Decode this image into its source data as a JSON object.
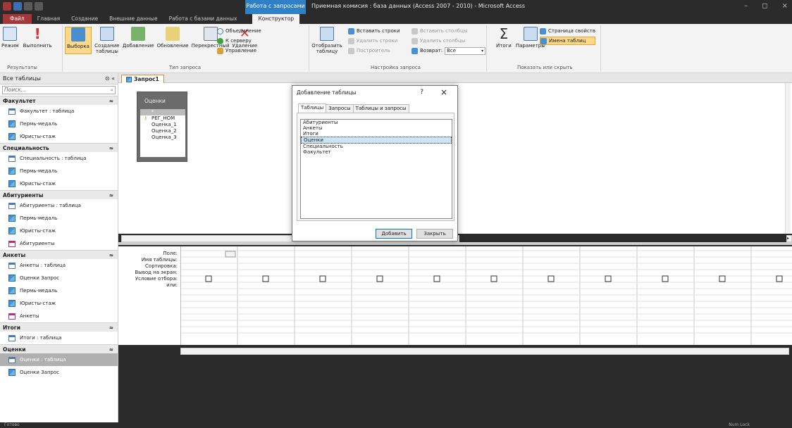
{
  "window": {
    "context_group": "Работа с запросами",
    "title": "Приемная комисия : база данных (Access 2007 - 2010) - Microsoft Access",
    "min": "–",
    "max": "◻",
    "close": "×"
  },
  "tabs": [
    "Файл",
    "Главная",
    "Создание",
    "Внешние данные",
    "Работа с базами данных",
    "Конструктор"
  ],
  "ribbon": {
    "results": {
      "label": "Результаты",
      "view": "Режим",
      "run": "Выполнить"
    },
    "query_type": {
      "label": "Тип запроса",
      "select": "Выборка",
      "make_table": "Создание таблицы",
      "append": "Добавление",
      "update": "Обновление",
      "crosstab": "Перекрестный",
      "delete": "Удаление",
      "union": "Объединение",
      "passthrough": "К серверу",
      "ddl": "Управление"
    },
    "setup": {
      "label": "Настройка запроса",
      "show_table": "Отобразить таблицу",
      "insert_rows": "Вставить строки",
      "delete_rows": "Удалить строки",
      "builder": "Построитель",
      "insert_cols": "Вставить столбцы",
      "delete_cols": "Удалить столбцы",
      "return": "Возврат:",
      "return_value": "Все"
    },
    "showhide": {
      "label": "Показать или скрыть",
      "totals": "Итоги",
      "params": "Параметры",
      "prop_sheet": "Страница свойств",
      "table_names": "Имена таблиц"
    }
  },
  "nav": {
    "header": "Все таблицы",
    "search_placeholder": "Поиск...",
    "groups": [
      {
        "name": "Факультет",
        "items": [
          {
            "label": "Факультет : таблица",
            "kind": "table"
          },
          {
            "label": "Пермь-медаль",
            "kind": "query"
          },
          {
            "label": "Юристы-стаж",
            "kind": "query"
          }
        ]
      },
      {
        "name": "Специальность",
        "items": [
          {
            "label": "Специальность : таблица",
            "kind": "table"
          },
          {
            "label": "Пермь-медаль",
            "kind": "query"
          },
          {
            "label": "Юристы-стаж",
            "kind": "query"
          }
        ]
      },
      {
        "name": "Абитуриенты",
        "items": [
          {
            "label": "Абитуриенты : таблица",
            "kind": "table"
          },
          {
            "label": "Пермь-медаль",
            "kind": "query"
          },
          {
            "label": "Юристы-стаж",
            "kind": "query"
          },
          {
            "label": "Абитуриенты",
            "kind": "form"
          }
        ]
      },
      {
        "name": "Анкеты",
        "items": [
          {
            "label": "Анкеты : таблица",
            "kind": "table"
          },
          {
            "label": "Оценки Запрос",
            "kind": "query"
          },
          {
            "label": "Пермь-медаль",
            "kind": "query"
          },
          {
            "label": "Юристы-стаж",
            "kind": "query"
          },
          {
            "label": "Анкеты",
            "kind": "form"
          }
        ]
      },
      {
        "name": "Итоги",
        "items": [
          {
            "label": "Итоги : таблица",
            "kind": "table"
          }
        ]
      },
      {
        "name": "Оценки",
        "items": [
          {
            "label": "Оценки : таблица",
            "kind": "table",
            "selected": true
          },
          {
            "label": "Оценки Запрос",
            "kind": "query"
          }
        ]
      }
    ]
  },
  "doc_tab": "Запрос1",
  "field_list": {
    "title": "Оценки",
    "fields": [
      "*",
      "РЕГ_НОМ",
      "Оценка_1",
      "Оценка_2",
      "Оценка_3"
    ]
  },
  "grid_labels": [
    "Поле:",
    "Имя таблицы:",
    "Сортировка:",
    "Вывод на экран:",
    "Условие отбора:",
    "или:"
  ],
  "dialog": {
    "title": "Добавление таблицы",
    "help": "?",
    "close": "×",
    "tabs": [
      "Таблицы",
      "Запросы",
      "Таблицы и запросы"
    ],
    "items": [
      "Абитуриенты",
      "Анкеты",
      "Итоги",
      "Оценки",
      "Специальность",
      "Факультет"
    ],
    "selected": "Оценки",
    "add": "Добавить",
    "close_btn": "Закрыть"
  },
  "status": {
    "left": "Готово",
    "right": "Num Lock"
  },
  "colors": {
    "accent": "#2f80c6",
    "file_tab": "#a4373a",
    "query_tab_border": "#d08a3a"
  }
}
